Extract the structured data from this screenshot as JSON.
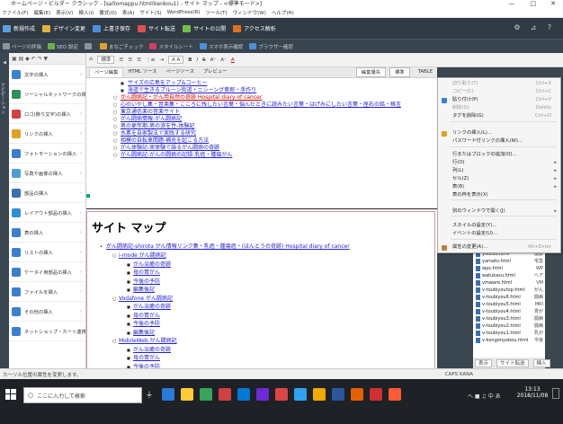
{
  "window": {
    "title": "ホームページ・ビルダー クラシック - [saitomappu.html(kenkou1) - サイト マップ - <標準モード>]",
    "minimize": "—",
    "maximize": "□",
    "close": "✕"
  },
  "menu": [
    "ファイル(F)",
    "編集(E)",
    "表示(V)",
    "挿入(I)",
    "書式(O)",
    "表(A)",
    "サイト(S)",
    "WordPress(R)",
    "ツール(T)",
    "ウィンドウ(W)",
    "ヘルプ(H)"
  ],
  "toolbar1": [
    {
      "label": "新規作成",
      "color": "#5aa0e0"
    },
    {
      "label": "デザイン変更",
      "color": "#e0b040"
    },
    {
      "label": "上書き保存",
      "color": "#4a90d9"
    },
    {
      "label": "サイト転送",
      "color": "#e05050"
    },
    {
      "label": "サイトの公開",
      "color": "#6fbf4a"
    },
    {
      "label": "アクセス解析",
      "color": "#e07020"
    }
  ],
  "toolbar2": [
    {
      "label": "ページの評価",
      "color": "#8a949c"
    },
    {
      "label": "SEO 設定",
      "color": "#6ab04c"
    },
    {
      "label": "",
      "color": "#8a949c"
    },
    {
      "label": "まなごチェック",
      "color": "#e0a030"
    },
    {
      "label": "スタイルシート",
      "color": "#d04060"
    },
    {
      "label": "スマホ表示確認",
      "color": "#4a90d9"
    },
    {
      "label": "ブラウザー確認",
      "color": "#4a90d9"
    }
  ],
  "left_panel": {
    "tools": "▣ ▤ ◆ ↶ ↷ ▼",
    "strip_label": "ナビゲーション",
    "items": [
      {
        "label": "文字の挿入",
        "color": "#3a7fd0"
      },
      {
        "label": "ソーシャルネットワークの挿",
        "color": "#2f8f5a"
      },
      {
        "label": "ロゴ(飾り文字)の挿入",
        "color": "#d04040"
      },
      {
        "label": "リンクの挿入",
        "color": "#e0a020"
      },
      {
        "label": "フォトモーションの挿入",
        "color": "#3a7fd0"
      },
      {
        "label": "写真や画像の挿入",
        "color": "#4a9fd0"
      },
      {
        "label": "部品の挿入",
        "color": "#3a6fb0"
      },
      {
        "label": "レイアウト部品の挿入",
        "color": "#2f8fd0"
      },
      {
        "label": "表の挿入",
        "color": "#3a7fd0"
      },
      {
        "label": "リストの挿入",
        "color": "#3a7fd0"
      },
      {
        "label": "ケータイ用部品の挿入",
        "color": "#3a7fd0"
      },
      {
        "label": "ファイルを挿入",
        "color": "#3a7fd0"
      },
      {
        "label": "その他の挿入",
        "color": "#3a7fd0"
      },
      {
        "label": "ネットショップ・カート連携",
        "color": "#3a7fd0"
      }
    ]
  },
  "format_bar": {
    "style": "標準",
    "zoom": "A A",
    "items": [
      "B",
      "I",
      "S",
      "A⁺",
      "A⁻",
      "A"
    ]
  },
  "tabs": [
    "ページ編集",
    "HTML ソース",
    "ページソース",
    "プレビュー"
  ],
  "tab_right": {
    "edit_mode": "編集優先",
    "standard": "標準",
    "table": "TABLE"
  },
  "editor": {
    "upper_list": [
      "サイズの広島をアップ&コーヒー",
      "海道で生きるプルーン街道・ニシーング紫郎・手作り",
      "がん闘病記・がん用自然の奇跡 Hospital diary of cancer",
      "心のいやし集・音楽集・こころに残したい言葉・悩んだときに読みたい言葉・はげみにしたい言葉・座右の銘・格言",
      "東京通信楽の音楽サイト",
      "がん闘病情報-がん闘病記",
      "男の更年期-男の涙を性-体験記",
      "水素を自家製法で実践する研究",
      "相模の自転車間題-補充を起こる方法",
      "がん体験記-実体験で語るがん闘病の奇跡",
      "がん闘病記-がんの闘病の記録-乳癌・腫瘍がん"
    ],
    "sitemap_title": "サイト マップ",
    "sm_top": "がん闘病記-shirota がん情報リンク集・乳癌・腫瘍癌・(はんとうの奇跡) Hospital diary of cancer",
    "groups": [
      {
        "head": "i-mode がん闘病記",
        "items": [
          "がん治癒の奇跡",
          "母の胃がん",
          "今後の予防",
          "編集後記"
        ]
      },
      {
        "head": "Vodafone がん闘病記",
        "items": [
          "がん治癒の奇跡",
          "母の胃がん",
          "今後の予防",
          "編集後記"
        ]
      },
      {
        "head": "MobileWeb がん闘病記",
        "items": [
          "がん治癒の奇跡",
          "母の胃がん",
          "今後の予防"
        ]
      }
    ]
  },
  "context_menu": [
    {
      "label": "切り取り(T)",
      "shortcut": "Ctrl+X",
      "disabled": true
    },
    {
      "label": "コピー(C)",
      "shortcut": "Ctrl+C",
      "disabled": true
    },
    {
      "label": "貼り付け(P)",
      "shortcut": "Ctrl+V",
      "disabled": false
    },
    {
      "label": "削除(D)",
      "shortcut": "Delete",
      "disabled": true
    },
    {
      "label": "タグを削除(G)",
      "shortcut": "Ctrl+D",
      "disabled": false
    },
    {
      "label": "リンクの挿入(L)...",
      "shortcut": "",
      "disabled": false
    },
    {
      "label": "パスワード付リンクの挿入(W)...",
      "shortcut": "",
      "disabled": false
    },
    {
      "label": "行またはブロックの追加(Q)...",
      "shortcut": "",
      "disabled": false
    },
    {
      "label": "行(O)",
      "shortcut": "",
      "disabled": false,
      "sub": true
    },
    {
      "label": "列(L)",
      "shortcut": "",
      "disabled": false,
      "sub": true
    },
    {
      "label": "セル(Z)",
      "shortcut": "",
      "disabled": false,
      "sub": true
    },
    {
      "label": "表(B)",
      "shortcut": "",
      "disabled": false,
      "sub": true
    },
    {
      "label": "表の枠を表示(X)",
      "shortcut": "",
      "disabled": false
    },
    {
      "label": "別のウィンドウで開く(J)",
      "shortcut": "",
      "disabled": false,
      "sub": true
    },
    {
      "label": "スタイルの設定(Y)...",
      "shortcut": "",
      "disabled": false
    },
    {
      "label": "イベントの設定(U)...",
      "shortcut": "",
      "disabled": false
    },
    {
      "label": "属性の変更(A)...",
      "shortcut": "Alt+Enter",
      "disabled": false
    }
  ],
  "right_files": [
    {
      "name": "youtuo.html",
      "size": "健康"
    },
    {
      "name": "yamato.html",
      "size": "宅急"
    },
    {
      "name": "wps.html",
      "size": "WP"
    },
    {
      "name": "watukasu.html",
      "size": "ヘア"
    },
    {
      "name": "vmware.html",
      "size": "VM"
    },
    {
      "name": "v-toubiyoutop.html",
      "size": "がん"
    },
    {
      "name": "v-toubiyou6.html",
      "size": "闘病"
    },
    {
      "name": "v-toubiyou5.html",
      "size": "MRI"
    },
    {
      "name": "v-toubiyou4.html",
      "size": "胃が"
    },
    {
      "name": "v-toubiyou3.html",
      "size": "闘病"
    },
    {
      "name": "v-toubiyou2.html",
      "size": "闘病"
    },
    {
      "name": "v-toubiyou1.html",
      "size": "乳が"
    },
    {
      "name": "v-kongonyobou.html",
      "size": "今後"
    }
  ],
  "right_bottom": {
    "view": "表示",
    "transfer": "サイト転送",
    "insert": "挿入"
  },
  "status": "カーソル位置の属性を変更します。",
  "status_right": "CAPS KANA",
  "taskbar": {
    "search_placeholder": "ここに入力して検索",
    "time": "13:13",
    "date": "2018/11/08",
    "tray": "へ ■ ♫ 中 あ",
    "icon_colors": [
      "#2a7bd6",
      "#ffcc33",
      "#3aa35a",
      "#d04040",
      "#0078d4",
      "#6c2bd9",
      "#dd4444",
      "#2ea3f2",
      "#f2a900",
      "#2b579a",
      "#e66000",
      "#d03030",
      "#ff5a36"
    ]
  }
}
